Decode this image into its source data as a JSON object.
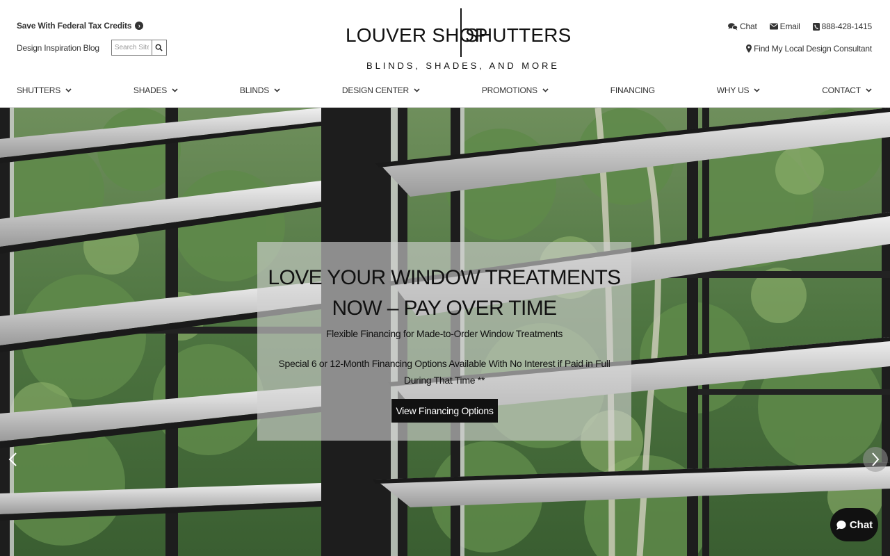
{
  "header": {
    "tax_credits": "Save With Federal Tax Credits",
    "blog": "Design Inspiration Blog",
    "search_placeholder": "Search Site",
    "logo": {
      "left": "LOUVER SHOP",
      "right": "SHUTTERS",
      "tagline": "BLINDS, SHADES, AND MORE"
    },
    "contact": {
      "chat": "Chat",
      "email": "Email",
      "phone": "888-428-1415",
      "consultant": "Find My Local Design Consultant"
    }
  },
  "nav": {
    "items": [
      {
        "label": "SHUTTERS",
        "dropdown": true
      },
      {
        "label": "SHADES",
        "dropdown": true
      },
      {
        "label": "BLINDS",
        "dropdown": true
      },
      {
        "label": "DESIGN CENTER",
        "dropdown": true
      },
      {
        "label": "PROMOTIONS",
        "dropdown": true
      },
      {
        "label": "FINANCING",
        "dropdown": false
      },
      {
        "label": "WHY US",
        "dropdown": true
      },
      {
        "label": "CONTACT",
        "dropdown": true
      }
    ]
  },
  "hero": {
    "title_line1": "LOVE YOUR WINDOW TREATMENTS",
    "title_line2": "NOW – PAY OVER TIME",
    "subtitle": "Flexible Financing for Made-to-Order Window Treatments",
    "description": "Special 6 or 12-Month Financing Options Available With No Interest if Paid in Full During That Time **",
    "button": "View Financing Options",
    "background_image": "window-shutters-forest-view"
  },
  "chat_widget": {
    "label": "Chat"
  },
  "colors": {
    "brand": "#111111",
    "text": "#333333",
    "caption_bg": "rgba(210,210,210,0.62)"
  }
}
